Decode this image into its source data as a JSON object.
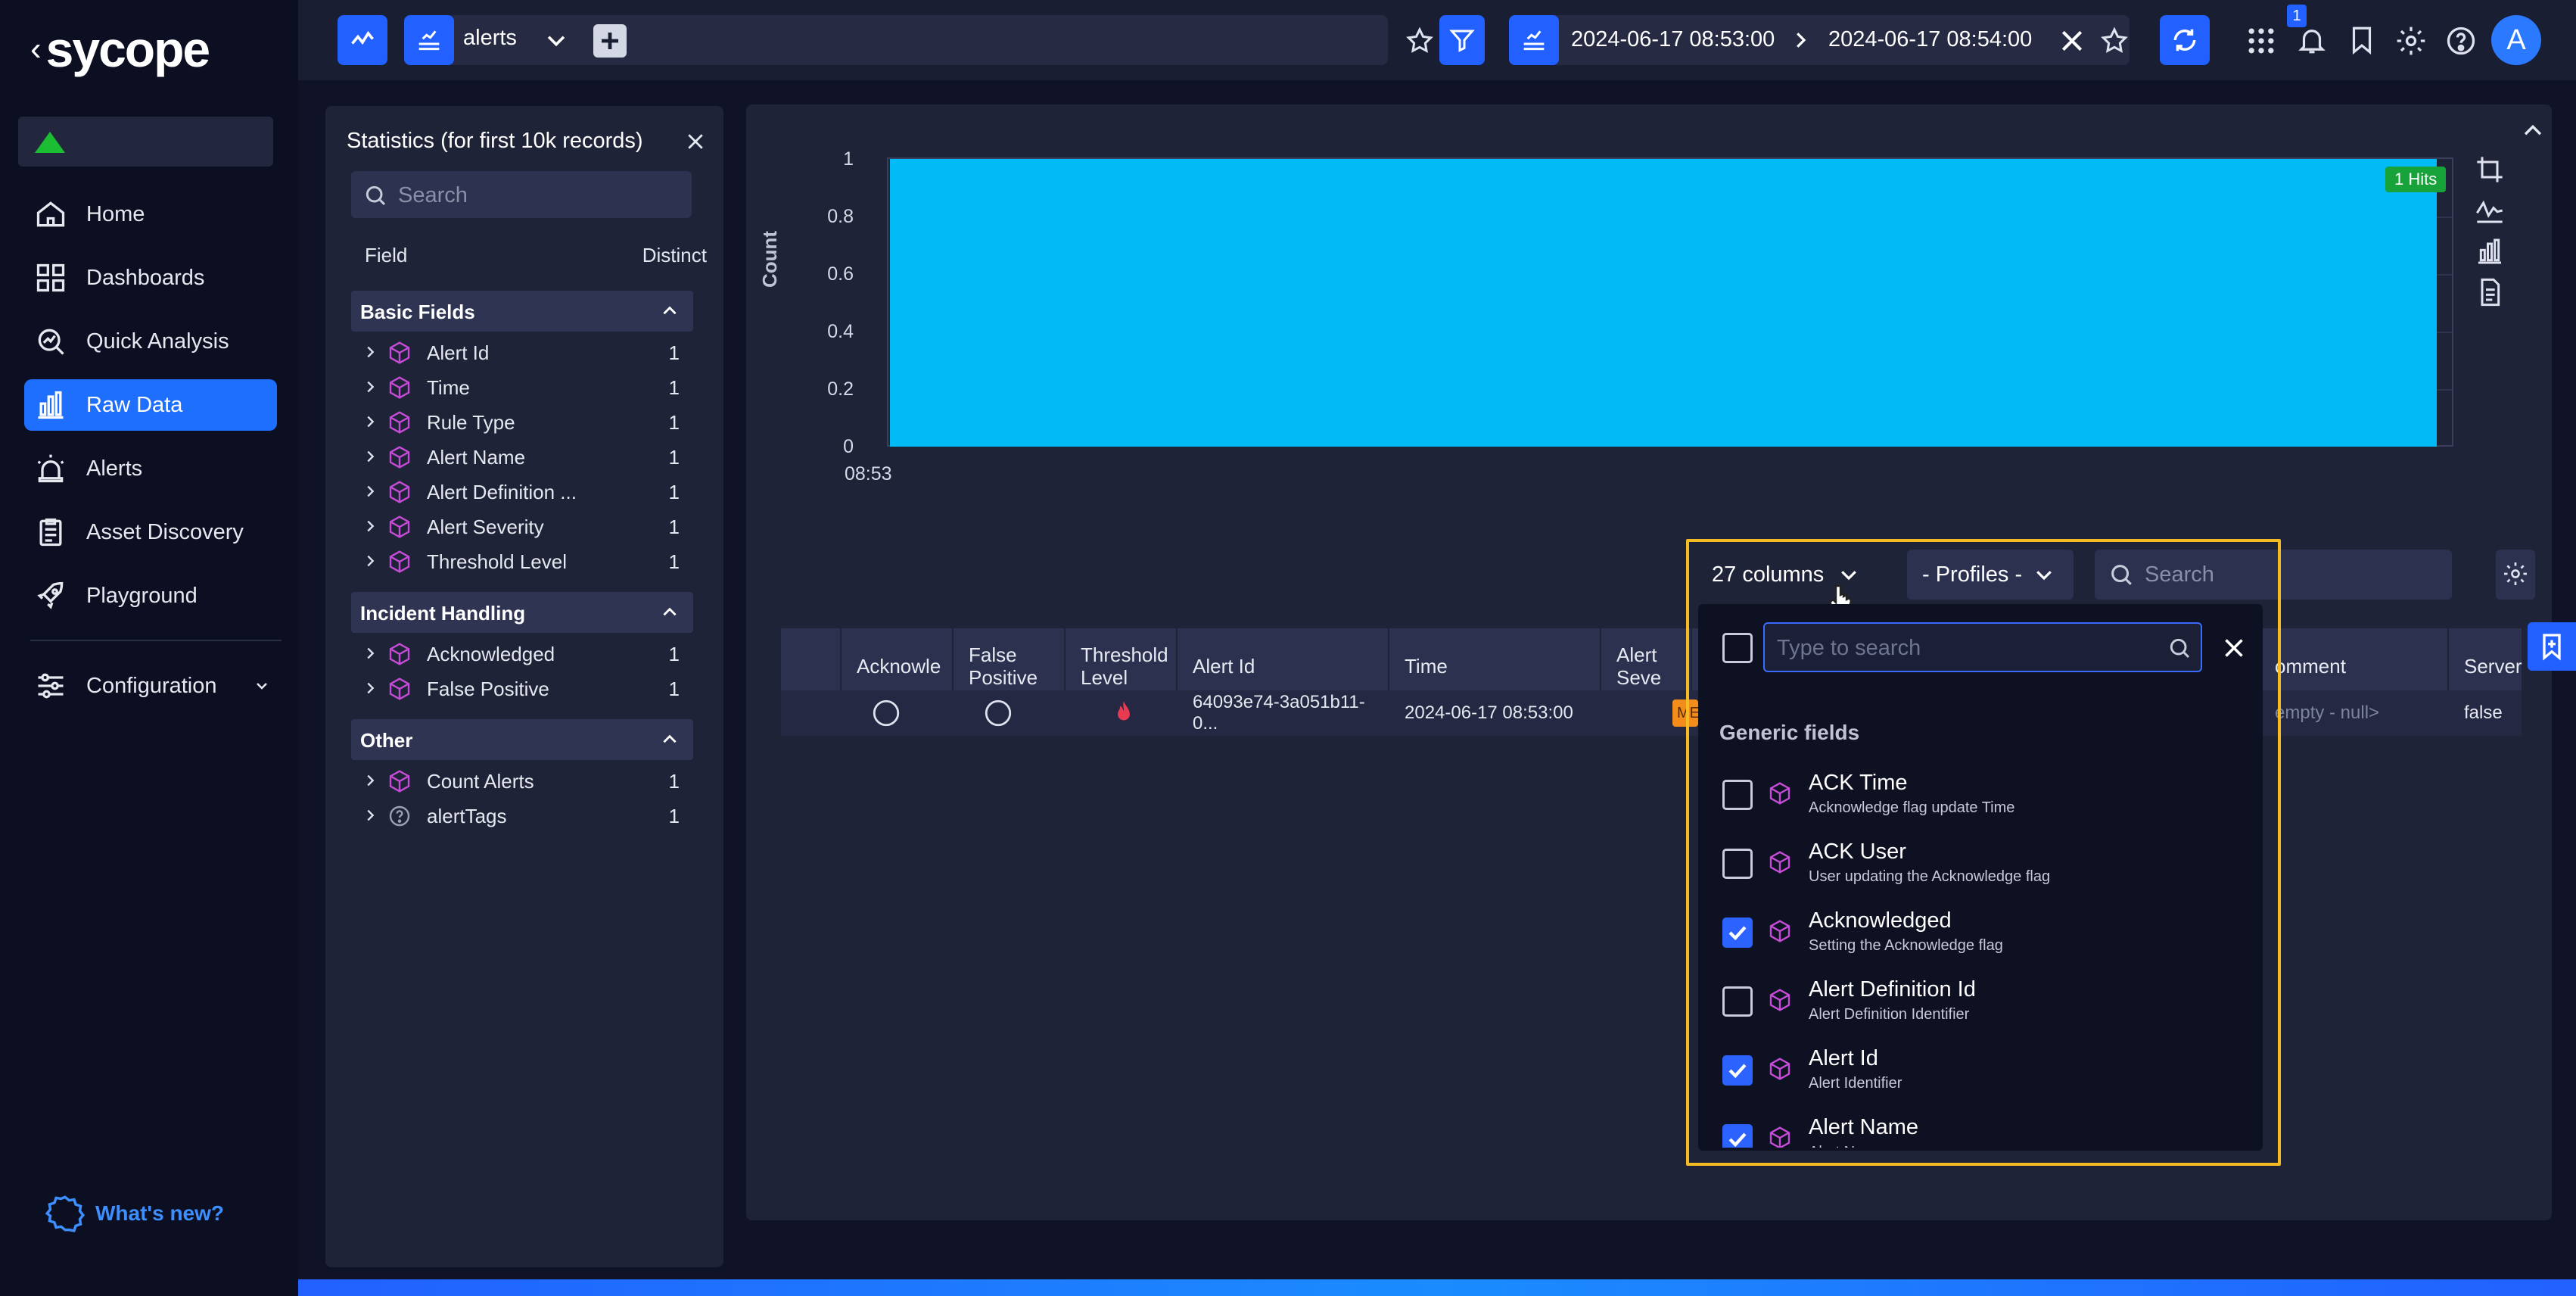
{
  "app": {
    "logo_text": "sycope"
  },
  "sidebar": {
    "items": [
      {
        "label": "Home"
      },
      {
        "label": "Dashboards"
      },
      {
        "label": "Quick Analysis"
      },
      {
        "label": "Raw Data"
      },
      {
        "label": "Alerts"
      },
      {
        "label": "Asset Discovery"
      },
      {
        "label": "Playground"
      }
    ],
    "configuration": "Configuration",
    "whats_new": "What's new?",
    "active": "Raw Data",
    "status_color": "#1bbd33"
  },
  "topbar": {
    "datasource": "alerts",
    "range_start": "2024-06-17 08:53:00",
    "range_end": "2024-06-17 08:54:00",
    "notification_count": "1",
    "avatar_letter": "A"
  },
  "stats": {
    "title": "Statistics (for first 10k records)",
    "search_placeholder": "Search",
    "col_field": "Field",
    "col_distinct": "Distinct",
    "groups": [
      {
        "name": "Basic Fields",
        "fields": [
          {
            "name": "Alert Id",
            "count": "1"
          },
          {
            "name": "Time",
            "count": "1"
          },
          {
            "name": "Rule Type",
            "count": "1"
          },
          {
            "name": "Alert Name",
            "count": "1"
          },
          {
            "name": "Alert Definition ...",
            "count": "1"
          },
          {
            "name": "Alert Severity",
            "count": "1"
          },
          {
            "name": "Threshold Level",
            "count": "1"
          }
        ]
      },
      {
        "name": "Incident Handling",
        "fields": [
          {
            "name": "Acknowledged",
            "count": "1"
          },
          {
            "name": "False Positive",
            "count": "1"
          }
        ]
      },
      {
        "name": "Other",
        "fields": [
          {
            "name": "Count Alerts",
            "count": "1"
          },
          {
            "name": "alertTags",
            "count": "1"
          }
        ]
      }
    ]
  },
  "chart_data": {
    "type": "bar",
    "ylabel": "Count",
    "yticks": [
      "1",
      "0.8",
      "0.6",
      "0.4",
      "0.2",
      "0"
    ],
    "ylim": [
      0,
      1
    ],
    "categories": [
      "08:53"
    ],
    "values": [
      1
    ],
    "badge": "1 Hits",
    "bar_color": "#00bbf5"
  },
  "table": {
    "controls": {
      "columns": "27 columns",
      "profiles": "- Profiles -",
      "search_placeholder": "Search"
    },
    "headers": [
      "Acknowle",
      "False Positive",
      "Threshold Level",
      "Alert Id",
      "Time",
      "Alert Seve",
      "omment",
      "Server"
    ],
    "row": {
      "alert_id": "64093e74-3a051b11-0...",
      "time": "2024-06-17 08:53:00",
      "severity": "ME",
      "comment": "empty - null>",
      "server": "false"
    }
  },
  "column_picker": {
    "search_placeholder": "Type to search",
    "section": "Generic fields",
    "options": [
      {
        "title": "ACK Time",
        "sub": "Acknowledge flag update Time",
        "checked": false
      },
      {
        "title": "ACK User",
        "sub": "User updating the Acknowledge flag",
        "checked": false
      },
      {
        "title": "Acknowledged",
        "sub": "Setting the Acknowledge flag",
        "checked": true
      },
      {
        "title": "Alert Definition Id",
        "sub": "Alert Definition Identifier",
        "checked": false
      },
      {
        "title": "Alert Id",
        "sub": "Alert Identifier",
        "checked": true
      },
      {
        "title": "Alert Name",
        "sub": "Alert Name",
        "checked": true
      }
    ],
    "highlight_color": "#f4bb22"
  }
}
